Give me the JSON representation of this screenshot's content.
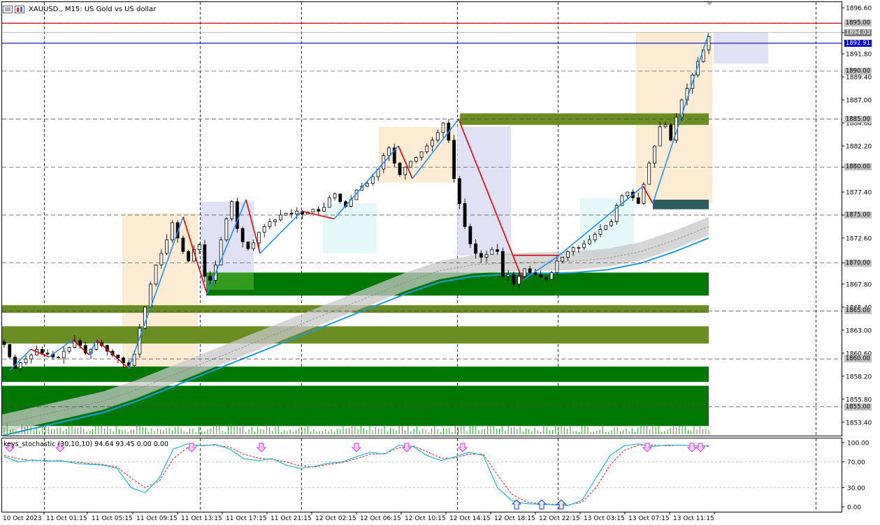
{
  "header": {
    "symbol_title": "XAUUSD., M15:  US Gold vs US dollar"
  },
  "indicator": {
    "title": "keys_stochastic (30,10,10) 94.64 93.45 0.00 0.00"
  },
  "price_axis": {
    "ticks": [
      "1896.60",
      "1894.00",
      "1891.80",
      "1889.40",
      "1887.00",
      "1884.60",
      "1882.20",
      "1880.00",
      "1877.40",
      "1875.00",
      "1872.60",
      "1870.00",
      "1867.80",
      "1865.40",
      "1863.00",
      "1860.60",
      "1858.20",
      "1855.80",
      "1853.40"
    ],
    "highlight_labels": [
      {
        "text": "1895.00",
        "color": "#c0c0c0",
        "text_color": "#000000"
      },
      {
        "text": "1894.03",
        "color": "#808080",
        "text_color": "#ffffff"
      },
      {
        "text": "1892.91",
        "color": "#0000cc",
        "text_color": "#ffffff"
      },
      {
        "text": "1890.00",
        "color": "#c0c0c0",
        "text_color": "#000000"
      },
      {
        "text": "1885.00",
        "color": "#c0c0c0",
        "text_color": "#000000"
      },
      {
        "text": "1880.00",
        "color": "#c0c0c0",
        "text_color": "#000000"
      },
      {
        "text": "1875.00",
        "color": "#c0c0c0",
        "text_color": "#000000"
      },
      {
        "text": "1870.00",
        "color": "#c0c0c0",
        "text_color": "#000000"
      },
      {
        "text": "1865.00",
        "color": "#c0c0c0",
        "text_color": "#000000"
      },
      {
        "text": "1860.00",
        "color": "#c0c0c0",
        "text_color": "#000000"
      },
      {
        "text": "1855.00",
        "color": "#c0c0c0",
        "text_color": "#000000"
      }
    ]
  },
  "indicator_axis": {
    "ticks": [
      "100.00",
      "70.00",
      "30.00",
      "0.00"
    ]
  },
  "time_axis": {
    "ticks": [
      "10 Oct 2023",
      "11 Oct 01:15",
      "11 Oct 05:15",
      "11 Oct 09:15",
      "11 Oct 13:15",
      "11 Oct 17:15",
      "11 Oct 21:15",
      "12 Oct 02:15",
      "12 Oct 06:15",
      "12 Oct 10:15",
      "12 Oct 14:15",
      "12 Oct 18:15",
      "12 Oct 22:15",
      "13 Oct 03:15",
      "13 Oct 07:15",
      "13 Oct 11:15"
    ]
  },
  "colors": {
    "bid_line": "#0000cc",
    "resistance_line": "#cc0000",
    "zone_dark_green": "#007700",
    "zone_olive": "#6b8e23",
    "ma_line": "#1e9be0",
    "zigzag_up": "#1e90ff",
    "zigzag_down": "#dd0000"
  },
  "chart_data": {
    "type": "candlestick",
    "symbol": "XAUUSD.",
    "timeframe": "M15",
    "ylim": [
      1852.0,
      1897.2
    ],
    "close_path": [
      1861.5,
      1860.2,
      1859.0,
      1859.6,
      1860.0,
      1860.4,
      1861.0,
      1860.6,
      1860.5,
      1860.2,
      1860.1,
      1860.8,
      1861.2,
      1861.9,
      1861.4,
      1860.6,
      1861.0,
      1861.7,
      1861.4,
      1860.8,
      1860.4,
      1860.1,
      1859.6,
      1859.3,
      1860.5,
      1863.2,
      1865.4,
      1867.8,
      1869.8,
      1871.0,
      1872.4,
      1874.2,
      1872.6,
      1871.2,
      1870.2,
      1871.4,
      1871.9,
      1868.6,
      1868.2,
      1869.8,
      1872.4,
      1874.6,
      1876.4,
      1873.6,
      1872.2,
      1871.5,
      1872.1,
      1873.2,
      1873.8,
      1874.3,
      1874.5,
      1875.0,
      1875.2,
      1875.1,
      1875.4,
      1875.1,
      1875.3,
      1875.6,
      1875.4,
      1875.8,
      1876.8,
      1877.2,
      1876.4,
      1875.9,
      1876.6,
      1877.6,
      1878.0,
      1878.3,
      1879.0,
      1879.8,
      1881.2,
      1882.0,
      1880.4,
      1879.2,
      1880.0,
      1880.6,
      1881.0,
      1881.6,
      1882.2,
      1882.8,
      1883.6,
      1884.6,
      1882.8,
      1878.8,
      1876.2,
      1873.8,
      1872.0,
      1871.0,
      1870.6,
      1870.9,
      1871.4,
      1871.2,
      1868.6,
      1868.8,
      1867.8,
      1868.6,
      1869.4,
      1869.0,
      1868.8,
      1868.5,
      1868.3,
      1869.0,
      1870.2,
      1870.6,
      1871.2,
      1871.6,
      1871.6,
      1872.0,
      1872.4,
      1873.0,
      1873.5,
      1873.9,
      1874.3,
      1876.0,
      1877.0,
      1877.4,
      1876.8,
      1876.2,
      1878.2,
      1880.4,
      1882.2,
      1884.2,
      1884.4,
      1882.8,
      1885.2,
      1887.0,
      1888.2,
      1889.6,
      1891.0,
      1892.2,
      1893.6
    ],
    "levels": [
      {
        "name": "bid",
        "value": 1892.91
      },
      {
        "name": "resistance",
        "value": 1895.0
      }
    ],
    "zones": [
      {
        "type": "demand",
        "from": 1866.6,
        "to": 1869.0
      },
      {
        "type": "demand",
        "from": 1857.6,
        "to": 1859.2
      },
      {
        "type": "demand",
        "from": 1853.0,
        "to": 1857.2
      },
      {
        "type": "supply",
        "from": 1864.8,
        "to": 1865.6
      },
      {
        "type": "supply",
        "from": 1861.6,
        "to": 1863.4
      },
      {
        "type": "supply",
        "from": 1884.4,
        "to": 1885.6
      }
    ],
    "ma": [
      1852.0,
      1852.8,
      1853.6,
      1854.4,
      1855.6,
      1857.0,
      1858.4,
      1859.8,
      1861.2,
      1862.6,
      1864.0,
      1865.4,
      1866.8,
      1868.0,
      1868.6,
      1868.8,
      1868.9,
      1869.0,
      1869.3,
      1870.0,
      1871.2,
      1872.6
    ],
    "stochastic": {
      "k": [
        78,
        70,
        73,
        71,
        72,
        68,
        66,
        65,
        60,
        30,
        22,
        45,
        90,
        98,
        95,
        97,
        90,
        75,
        72,
        75,
        65,
        60,
        63,
        68,
        70,
        78,
        85,
        82,
        96,
        94,
        80,
        72,
        78,
        85,
        80,
        30,
        10,
        5,
        4,
        3,
        2,
        10,
        45,
        80,
        95,
        98,
        94,
        96,
        96,
        95,
        95
      ],
      "d": [
        80,
        75,
        72,
        72,
        71,
        70,
        68,
        66,
        62,
        45,
        30,
        40,
        75,
        92,
        96,
        96,
        93,
        82,
        76,
        74,
        70,
        64,
        62,
        66,
        69,
        75,
        82,
        83,
        92,
        95,
        86,
        76,
        76,
        82,
        82,
        50,
        20,
        8,
        5,
        4,
        3,
        7,
        30,
        65,
        88,
        96,
        96,
        95,
        96,
        95,
        94
      ]
    }
  }
}
